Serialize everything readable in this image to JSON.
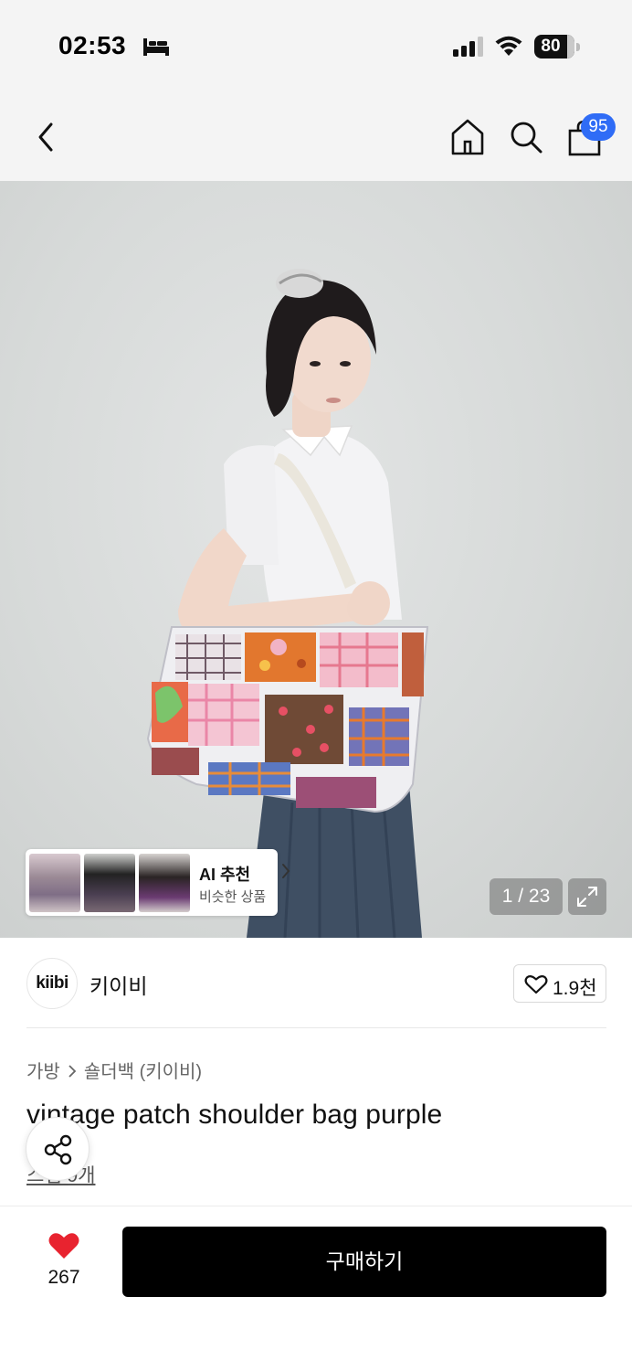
{
  "status_bar": {
    "time": "02:53",
    "battery": "80"
  },
  "nav": {
    "bag_badge": "95"
  },
  "hero": {
    "counter": "1 / 23",
    "ai_card": {
      "title": "AI 추천",
      "subtitle": "비슷한 상품"
    }
  },
  "brand": {
    "logo_text": "kiibi",
    "name": "키이비",
    "likes": "1.9천"
  },
  "product": {
    "breadcrumb": [
      "가방",
      "숄더백 (키이비)"
    ],
    "title": "vintage patch shoulder bag purple",
    "review_link": "스냅 9개"
  },
  "bottom": {
    "wish_count": "267",
    "buy_label": "구매하기"
  },
  "colors": {
    "badge": "#2f6cf6",
    "heart": "#e8232f",
    "buy_button": "#000000"
  },
  "icons": [
    "bed-icon",
    "signal-icon",
    "wifi-icon",
    "back-chevron-icon",
    "home-icon",
    "search-icon",
    "shopping-bag-icon",
    "chevron-right-icon",
    "expand-icon",
    "heart-outline-icon",
    "share-icon",
    "heart-filled-icon"
  ]
}
